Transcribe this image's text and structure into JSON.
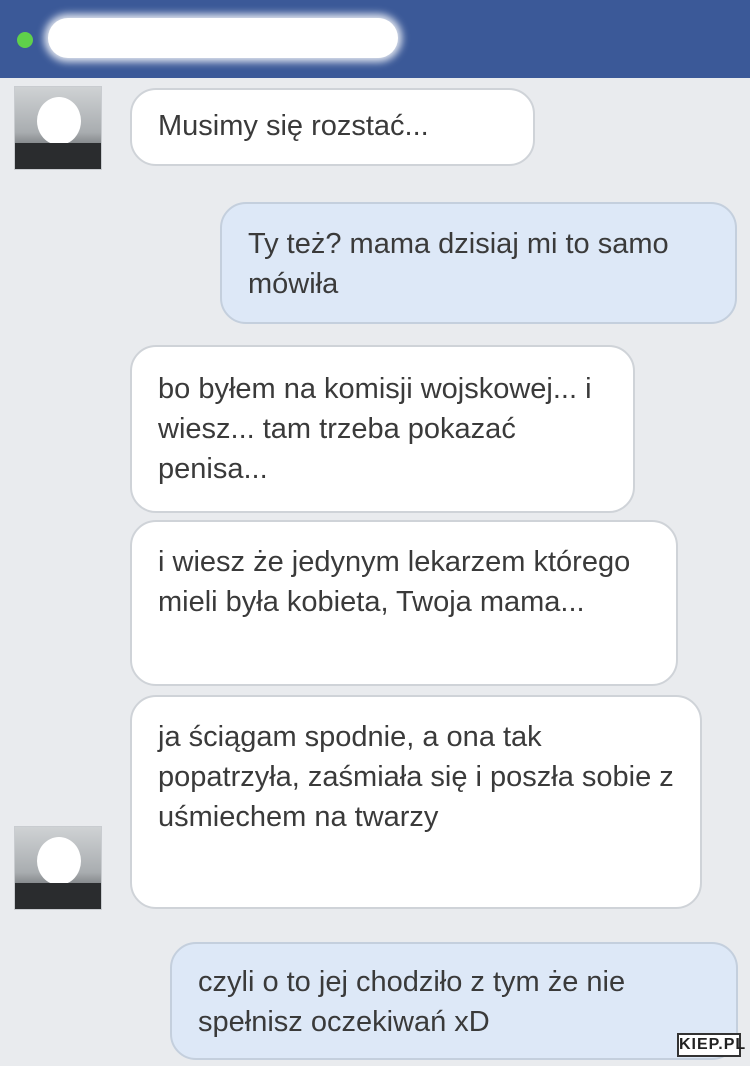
{
  "header": {
    "status": "online",
    "contact_name": ""
  },
  "messages": [
    {
      "from": "them",
      "text": "Musimy się rozstać..."
    },
    {
      "from": "me",
      "text": "Ty też? mama dzisiaj mi to samo mówiła"
    },
    {
      "from": "them",
      "text": "bo byłem na komisji wojskowej... i wiesz... tam trzeba pokazać penisa..."
    },
    {
      "from": "them",
      "text": "i wiesz że jedynym lekarzem którego mieli była kobieta, Twoja mama..."
    },
    {
      "from": "them",
      "text": "ja ściągam spodnie, a ona tak popatrzyła, zaśmiała się i poszła sobie z uśmiechem na twarzy"
    },
    {
      "from": "me",
      "text": "czyli o to jej chodziło z tym że nie spełnisz oczekiwań xD"
    }
  ],
  "watermark": "KIEP.PL",
  "colors": {
    "header": "#3b5998",
    "online": "#5fd14a",
    "incoming_bubble": "#ffffff",
    "outgoing_bubble": "#dde8f7",
    "background": "#e9ebee"
  }
}
